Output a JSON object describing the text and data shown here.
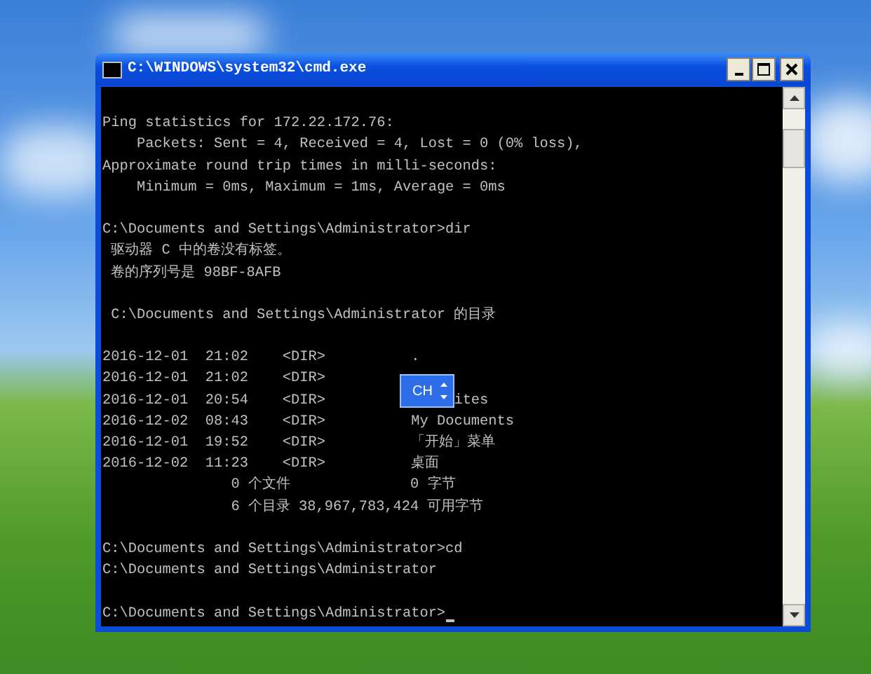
{
  "window": {
    "title": "C:\\WINDOWS\\system32\\cmd.exe"
  },
  "console": {
    "blocks": [
      [
        "Ping statistics for 172.22.172.76:",
        "    Packets: Sent = 4, Received = 4, Lost = 0 (0% loss),",
        "Approximate round trip times in milli-seconds:",
        "    Minimum = 0ms, Maximum = 1ms, Average = 0ms"
      ],
      [
        "C:\\Documents and Settings\\Administrator>dir",
        " 驱动器 C 中的卷没有标签。",
        " 卷的序列号是 98BF-8AFB"
      ],
      [
        " C:\\Documents and Settings\\Administrator 的目录"
      ],
      [
        "2016-12-01  21:02    <DIR>          .",
        "2016-12-01  21:02    <DIR>",
        "2016-12-01  20:54    <DIR>               ites",
        "2016-12-02  08:43    <DIR>          My Documents",
        "2016-12-01  19:52    <DIR>          「开始」菜单",
        "2016-12-02  11:23    <DIR>          桌面",
        "               0 个文件              0 字节",
        "               6 个目录 38,967,783,424 可用字节"
      ],
      [
        "C:\\Documents and Settings\\Administrator>cd",
        "C:\\Documents and Settings\\Administrator"
      ],
      [
        "C:\\Documents and Settings\\Administrator>"
      ]
    ]
  },
  "ime_indicator": {
    "label": "CH"
  }
}
